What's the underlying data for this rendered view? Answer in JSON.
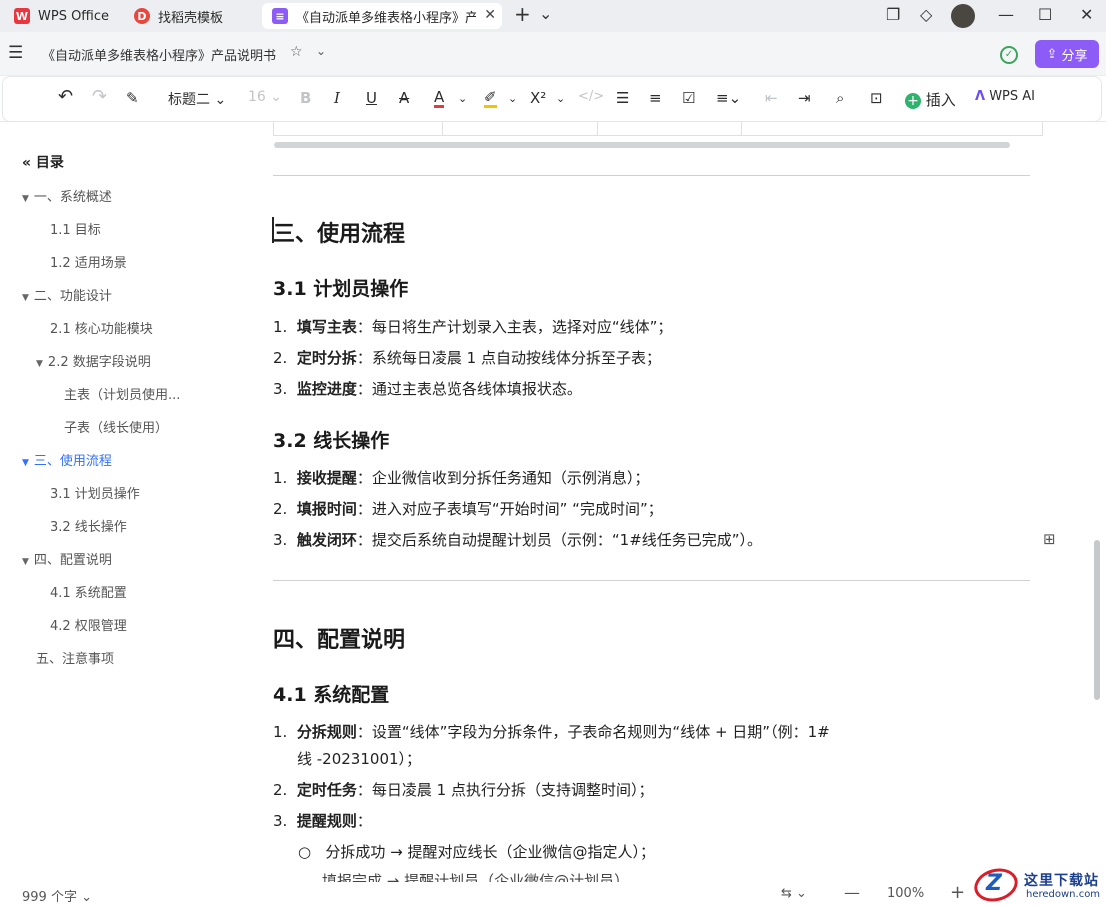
{
  "tabs": [
    {
      "label": "WPS Office",
      "icon": "wps-logo-icon"
    },
    {
      "label": "找稻壳模板",
      "icon": "docer-icon"
    },
    {
      "label": "《自动派单多维表格小程序》产品",
      "icon": "doc-icon"
    }
  ],
  "titlebar": {
    "add_tab": "+",
    "tab_menu": "⌄",
    "minimize": "—",
    "maximize": "☐",
    "close": "✕"
  },
  "doc": {
    "title": "《自动派单多维表格小程序》产品说明书"
  },
  "share_label": "分享",
  "toolbar": {
    "style_label": "标题二",
    "font_size": "16",
    "insert_label": "插入",
    "ai_label": "WPS AI"
  },
  "toc": {
    "title": "目录",
    "items": [
      {
        "label": "一、系统概述",
        "level": 1,
        "expanded": true
      },
      {
        "label": "1.1 目标",
        "level": 2
      },
      {
        "label": "1.2 适用场景",
        "level": 2
      },
      {
        "label": "二、功能设计",
        "level": 1,
        "expanded": true
      },
      {
        "label": "2.1 核心功能模块",
        "level": 2
      },
      {
        "label": "2.2 数据字段说明",
        "level": 2,
        "expanded": true
      },
      {
        "label": "主表（计划员使用...",
        "level": 3
      },
      {
        "label": "子表（线长使用）",
        "level": 3
      },
      {
        "label": "三、使用流程",
        "level": 1,
        "expanded": true,
        "active": true
      },
      {
        "label": "3.1 计划员操作",
        "level": 2
      },
      {
        "label": "3.2 线长操作",
        "level": 2
      },
      {
        "label": "四、配置说明",
        "level": 1,
        "expanded": true
      },
      {
        "label": "4.1 系统配置",
        "level": 2
      },
      {
        "label": "4.2 权限管理",
        "level": 2
      },
      {
        "label": "五、注意事项",
        "level": 1
      }
    ]
  },
  "content": {
    "h_section3": "三、使用流程",
    "h_31": "3.1 计划员操作",
    "list_31": [
      {
        "num": "1.",
        "bold": "填写主表",
        "text": "：每日将生产计划录入主表，选择对应“线体”；"
      },
      {
        "num": "2.",
        "bold": "定时分拆",
        "text": "：系统每日凌晨 1 点自动按线体分拆至子表；"
      },
      {
        "num": "3.",
        "bold": "监控进度",
        "text": "：通过主表总览各线体填报状态。"
      }
    ],
    "h_32": "3.2 线长操作",
    "list_32": [
      {
        "num": "1.",
        "bold": "接收提醒",
        "text": "：企业微信收到分拆任务通知（示例消息）；"
      },
      {
        "num": "2.",
        "bold": "填报时间",
        "text": "：进入对应子表填写“开始时间” “完成时间”；"
      },
      {
        "num": "3.",
        "bold": "触发闭环",
        "text": "：提交后系统自动提醒计划员（示例：“1#线任务已完成”）。"
      }
    ],
    "h_section4": "四、配置说明",
    "h_41": "4.1 系统配置",
    "list_41": [
      {
        "num": "1.",
        "bold": "分拆规则",
        "text": "：设置“线体”字段为分拆条件，子表命名规则为“线体 + 日期”（例：1#",
        "cont": "线 -20231001）；"
      },
      {
        "num": "2.",
        "bold": "定时任务",
        "text": "：每日凌晨 1 点执行分拆（支持调整时间）；"
      },
      {
        "num": "3.",
        "bold": "提醒规则",
        "text": "："
      }
    ],
    "sub_41": {
      "bullet": "○",
      "text": "分拆成功 → 提醒对应线长（企业微信@指定人）；"
    },
    "cut_line": "填报完成 → 提醒计划员（企业微信@计划员）"
  },
  "status": {
    "word_count": "999 个字",
    "zoom": "100%"
  },
  "watermark": {
    "cn": "这里下载站",
    "en": "heredown.com"
  }
}
